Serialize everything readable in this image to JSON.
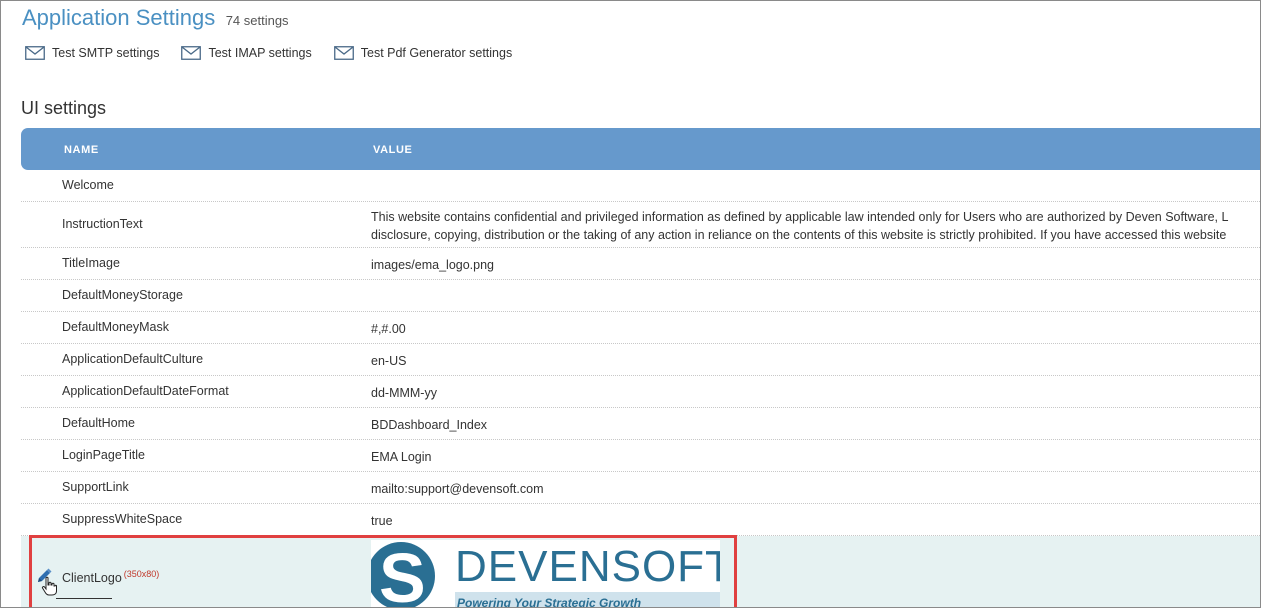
{
  "header": {
    "title": "Application Settings",
    "count": "74 settings"
  },
  "tests": [
    {
      "label": "Test SMTP settings",
      "icon": "envelope-icon"
    },
    {
      "label": "Test IMAP settings",
      "icon": "envelope-icon"
    },
    {
      "label": "Test Pdf Generator settings",
      "icon": "envelope-icon"
    }
  ],
  "section_title": "UI settings",
  "table": {
    "columns": [
      "NAME",
      "VALUE"
    ],
    "rows": [
      {
        "name": "Welcome",
        "value": ""
      },
      {
        "name": "InstructionText",
        "value_line1": "This website contains confidential and privileged information as defined by applicable law intended only for Users who are authorized by Deven Software, L",
        "value_line2": "disclosure, copying, distribution or the taking of any action in reliance on the contents of this website is strictly prohibited. If you have accessed this website"
      },
      {
        "name": "TitleImage",
        "value": "images/ema_logo.png"
      },
      {
        "name": "DefaultMoneyStorage",
        "value": ""
      },
      {
        "name": "DefaultMoneyMask",
        "value": "#,#.00"
      },
      {
        "name": "ApplicationDefaultCulture",
        "value": "en-US"
      },
      {
        "name": "ApplicationDefaultDateFormat",
        "value": "dd-MMM-yy"
      },
      {
        "name": "DefaultHome",
        "value": "BDDashboard_Index"
      },
      {
        "name": "LoginPageTitle",
        "value": "EMA Login"
      },
      {
        "name": "SupportLink",
        "value": "mailto:support@devensoft.com"
      },
      {
        "name": "SuppressWhiteSpace",
        "value": "true"
      }
    ],
    "client_logo": {
      "name": "ClientLogo",
      "size_hint": "(350x80)",
      "logo_word_a": "DEVEN",
      "logo_word_b": "SOFT",
      "logo_tagline": "Powering Your Strategic Growth",
      "logo_letter": "S"
    }
  },
  "colors": {
    "accent": "#4a90c2",
    "table_header": "#6699cc",
    "highlight_row": "#e6f2f2",
    "callout_border": "#e04040",
    "brand_logo": "#2a6f93"
  }
}
